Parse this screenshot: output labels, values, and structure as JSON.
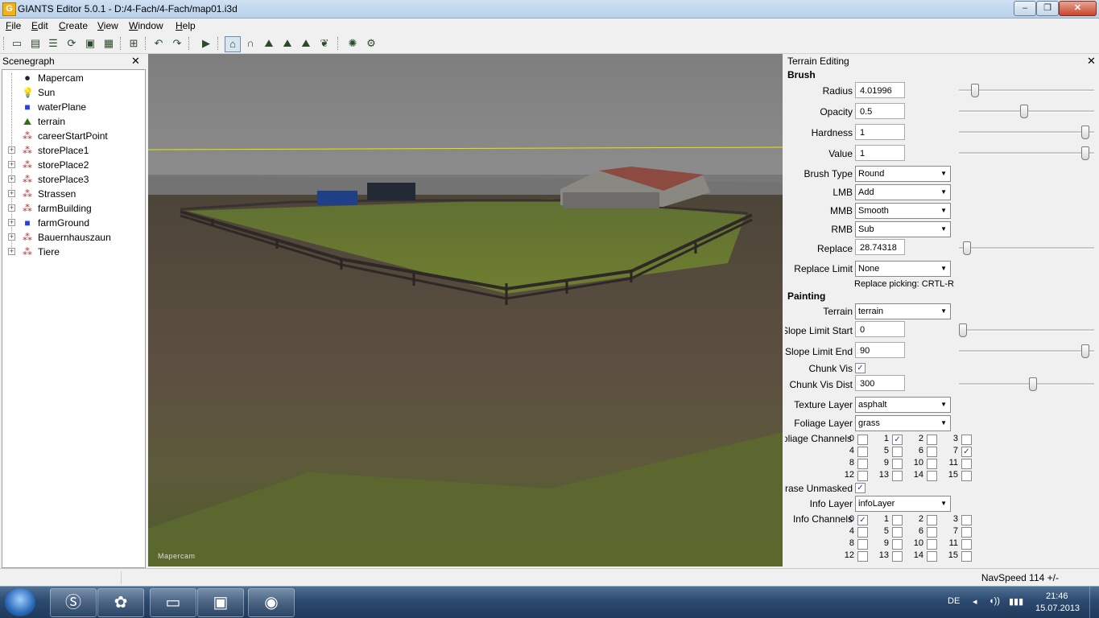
{
  "window": {
    "title": "GIANTS Editor 5.0.1 - D:/4-Fach/4-Fach/map01.i3d",
    "controls": [
      "–",
      "❐",
      "✕"
    ]
  },
  "menu": [
    "File",
    "Edit",
    "Create",
    "View",
    "Window",
    "Help"
  ],
  "scenegraph": {
    "title": "Scenegraph",
    "close": "✕",
    "items": [
      {
        "label": "Mapercam",
        "icon": "camera-icon",
        "expandable": false
      },
      {
        "label": "Sun",
        "icon": "light-bulb-icon",
        "expandable": false
      },
      {
        "label": "waterPlane",
        "icon": "cube-icon",
        "expandable": false
      },
      {
        "label": "terrain",
        "icon": "terrain-icon",
        "expandable": false
      },
      {
        "label": "careerStartPoint",
        "icon": "transform-group-icon",
        "expandable": false
      },
      {
        "label": "storePlace1",
        "icon": "transform-group-icon",
        "expandable": true
      },
      {
        "label": "storePlace2",
        "icon": "transform-group-icon",
        "expandable": true
      },
      {
        "label": "storePlace3",
        "icon": "transform-group-icon",
        "expandable": true
      },
      {
        "label": "Strassen",
        "icon": "transform-group-icon",
        "expandable": true
      },
      {
        "label": "farmBuilding",
        "icon": "transform-group-icon",
        "expandable": true
      },
      {
        "label": "farmGround",
        "icon": "cube-icon",
        "expandable": true
      },
      {
        "label": "Bauernhauszaun",
        "icon": "transform-group-icon",
        "expandable": true
      },
      {
        "label": "Tiere",
        "icon": "transform-group-icon",
        "expandable": true
      }
    ]
  },
  "viewport": {
    "camera_label": "Mapercam"
  },
  "terrain_editing": {
    "title": "Terrain Editing",
    "close": "✕",
    "brush_section": "Brush",
    "radius_label": "Radius",
    "radius_value": "4.01996",
    "radius_slider": 0.1,
    "opacity_label": "Opacity",
    "opacity_value": "0.5",
    "opacity_slider": 0.5,
    "hardness_label": "Hardness",
    "hardness_value": "1",
    "hardness_slider": 1.0,
    "value_label": "Value",
    "value_value": "1",
    "value_slider": 1.0,
    "brush_type_label": "Brush Type",
    "brush_type_value": "Round",
    "lmb_label": "LMB",
    "lmb_value": "Add",
    "mmb_label": "MMB",
    "mmb_value": "Smooth",
    "rmb_label": "RMB",
    "rmb_value": "Sub",
    "replace_label": "Replace",
    "replace_value": "28.74318",
    "replace_slider": 0.03,
    "replace_limit_label": "Replace Limit",
    "replace_limit_value": "None",
    "replace_hint": "Replace picking: CRTL-R",
    "painting_section": "Painting",
    "terrain_label": "Terrain",
    "terrain_value": "terrain",
    "slope_start_label": "Slope Limit Start",
    "slope_start_value": "0",
    "slope_start_slider": 0.0,
    "slope_end_label": "Slope Limit End",
    "slope_end_value": "90",
    "slope_end_slider": 1.0,
    "chunk_vis_label": "Chunk Vis",
    "chunk_vis_checked": true,
    "chunk_vis_dist_label": "Chunk Vis Dist",
    "chunk_vis_dist_value": "300",
    "chunk_vis_dist_slider": 0.57,
    "texture_layer_label": "Texture Layer",
    "texture_layer_value": "asphalt",
    "foliage_layer_label": "Foliage Layer",
    "foliage_layer_value": "grass",
    "foliage_channels_label": "Foliage Channels",
    "foliage_channels_checked": [
      1,
      7
    ],
    "erase_unmasked_label": "Erase Unmasked",
    "erase_unmasked_checked": true,
    "info_layer_label": "Info Layer",
    "info_layer_value": "infoLayer",
    "info_channels_label": "Info Channels",
    "info_channels_checked": [
      0
    ]
  },
  "statusbar": {
    "navspeed": "NavSpeed 114 +/-"
  },
  "taskbar": {
    "language": "DE",
    "time": "21:46",
    "date": "15.07.2013"
  }
}
